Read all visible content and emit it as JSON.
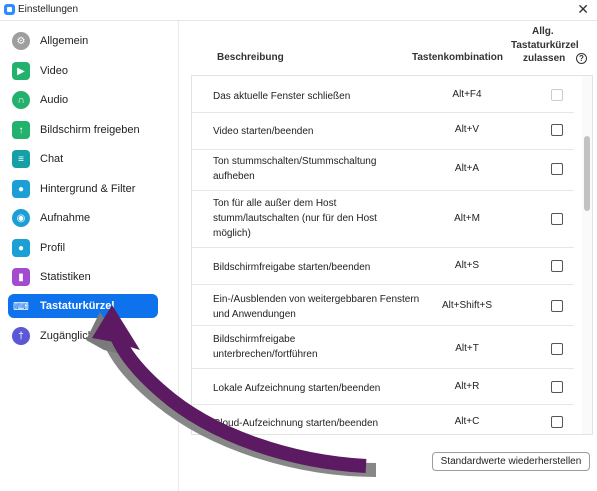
{
  "window": {
    "title": "Einstellungen",
    "close_label": "✕"
  },
  "sidebar": {
    "items": [
      {
        "label": "Allgemein",
        "icon": "gear-icon",
        "color": "#9e9e9e"
      },
      {
        "label": "Video",
        "icon": "video-icon",
        "color": "#23b26d"
      },
      {
        "label": "Audio",
        "icon": "headphones-icon",
        "color": "#23b26d"
      },
      {
        "label": "Bildschirm freigeben",
        "icon": "screen-share-icon",
        "color": "#23b26d"
      },
      {
        "label": "Chat",
        "icon": "chat-icon",
        "color": "#16a0a6"
      },
      {
        "label": "Hintergrund & Filter",
        "icon": "person-background-icon",
        "color": "#1c9fd5"
      },
      {
        "label": "Aufnahme",
        "icon": "record-icon",
        "color": "#1c9fd5"
      },
      {
        "label": "Profil",
        "icon": "profile-icon",
        "color": "#1c9fd5"
      },
      {
        "label": "Statistiken",
        "icon": "statistics-icon",
        "color": "#a24bd0"
      },
      {
        "label": "Tastaturkürzel",
        "icon": "keyboard-icon",
        "color": "#ffffff",
        "active": true
      },
      {
        "label": "Zugänglichkeit",
        "icon": "accessibility-icon",
        "color": "#5b57d6"
      }
    ]
  },
  "table": {
    "col_description": "Beschreibung",
    "col_shortcut": "Tastenkombination",
    "col_global_1": "Allg.",
    "col_global_2": "Tastaturkürzel",
    "col_global_3": "zulassen",
    "help": "?",
    "rows": [
      {
        "description": "Das aktuelle Fenster schließen",
        "keys": "Alt+F4",
        "global": false,
        "disabled": true
      },
      {
        "description": "Video starten/beenden",
        "keys": "Alt+V",
        "global": false
      },
      {
        "description": "Ton stummschalten/Stummschaltung aufheben",
        "keys": "Alt+A",
        "global": false
      },
      {
        "description": "Ton für alle außer dem Host stumm/lautschalten (nur für den Host möglich)",
        "keys": "Alt+M",
        "global": false
      },
      {
        "description": "Bildschirmfreigabe starten/beenden",
        "keys": "Alt+S",
        "global": false
      },
      {
        "description": "Ein-/Ausblenden von weitergebbaren Fenstern und Anwendungen",
        "keys": "Alt+Shift+S",
        "global": false
      },
      {
        "description": "Bildschirmfreigabe unterbrechen/fortführen",
        "keys": "Alt+T",
        "global": false
      },
      {
        "description": "Lokale Aufzeichnung starten/beenden",
        "keys": "Alt+R",
        "global": false
      },
      {
        "description": "Cloud-Aufzeichnung starten/beenden",
        "keys": "Alt+C",
        "global": false
      }
    ]
  },
  "reset_button": "Standardwerte wiederherstellen",
  "colors": {
    "accent": "#0e72ed",
    "arrow": "#5c1a63",
    "arrow_shadow": "#7a7a7a"
  }
}
